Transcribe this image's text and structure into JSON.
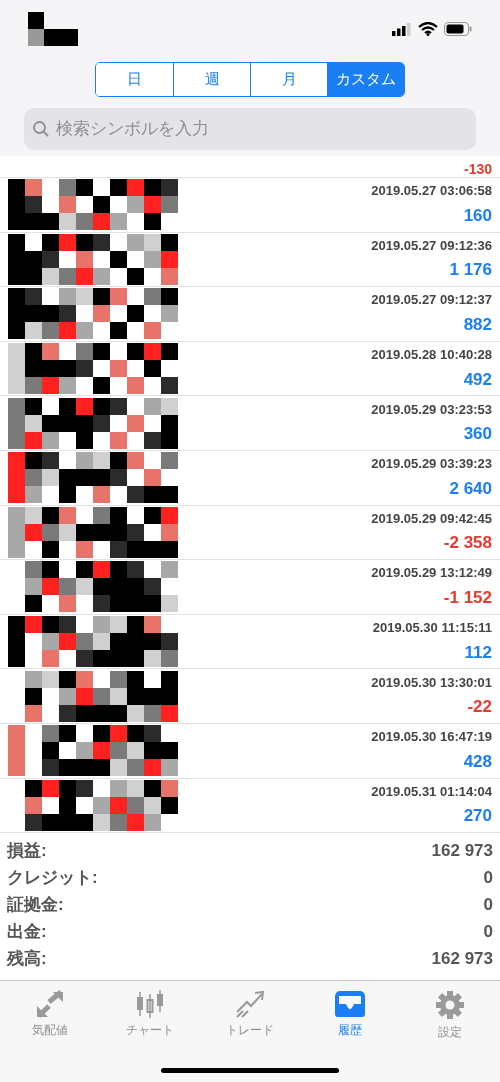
{
  "period_tabs": [
    {
      "label": "日",
      "selected": false
    },
    {
      "label": "週",
      "selected": false
    },
    {
      "label": "月",
      "selected": false
    },
    {
      "label": "カスタム",
      "selected": true
    }
  ],
  "search": {
    "placeholder": "検索シンボルを入力"
  },
  "partial_row": {
    "value": "-130",
    "kind": "loss"
  },
  "deals": [
    {
      "time": "2019.05.27 03:06:58",
      "value": "160",
      "kind": "profit"
    },
    {
      "time": "2019.05.27 09:12:36",
      "value": "1 176",
      "kind": "profit"
    },
    {
      "time": "2019.05.27 09:12:37",
      "value": "882",
      "kind": "profit"
    },
    {
      "time": "2019.05.28 10:40:28",
      "value": "492",
      "kind": "profit"
    },
    {
      "time": "2019.05.29 03:23:53",
      "value": "360",
      "kind": "profit"
    },
    {
      "time": "2019.05.29 03:39:23",
      "value": "2 640",
      "kind": "profit"
    },
    {
      "time": "2019.05.29 09:42:45",
      "value": "-2 358",
      "kind": "loss"
    },
    {
      "time": "2019.05.29 13:12:49",
      "value": "-1 152",
      "kind": "loss"
    },
    {
      "time": "2019.05.30 11:15:11",
      "value": "112",
      "kind": "profit"
    },
    {
      "time": "2019.05.30 13:30:01",
      "value": "-22",
      "kind": "loss"
    },
    {
      "time": "2019.05.30 16:47:19",
      "value": "428",
      "kind": "profit"
    },
    {
      "time": "2019.05.31 01:14:04",
      "value": "270",
      "kind": "profit"
    }
  ],
  "summary": [
    {
      "label": "損益:",
      "value": "162 973"
    },
    {
      "label": "クレジット:",
      "value": "0"
    },
    {
      "label": "証拠金:",
      "value": "0"
    },
    {
      "label": "出金:",
      "value": "0"
    },
    {
      "label": "残高:",
      "value": "162 973"
    }
  ],
  "tab_bar": [
    {
      "label": "気配値",
      "selected": false,
      "kind": "quotes"
    },
    {
      "label": "チャート",
      "selected": false,
      "kind": "chart"
    },
    {
      "label": "トレード",
      "selected": false,
      "kind": "trade"
    },
    {
      "label": "履歴",
      "selected": true,
      "kind": "history"
    },
    {
      "label": "設定",
      "selected": false,
      "kind": "settings"
    }
  ]
}
